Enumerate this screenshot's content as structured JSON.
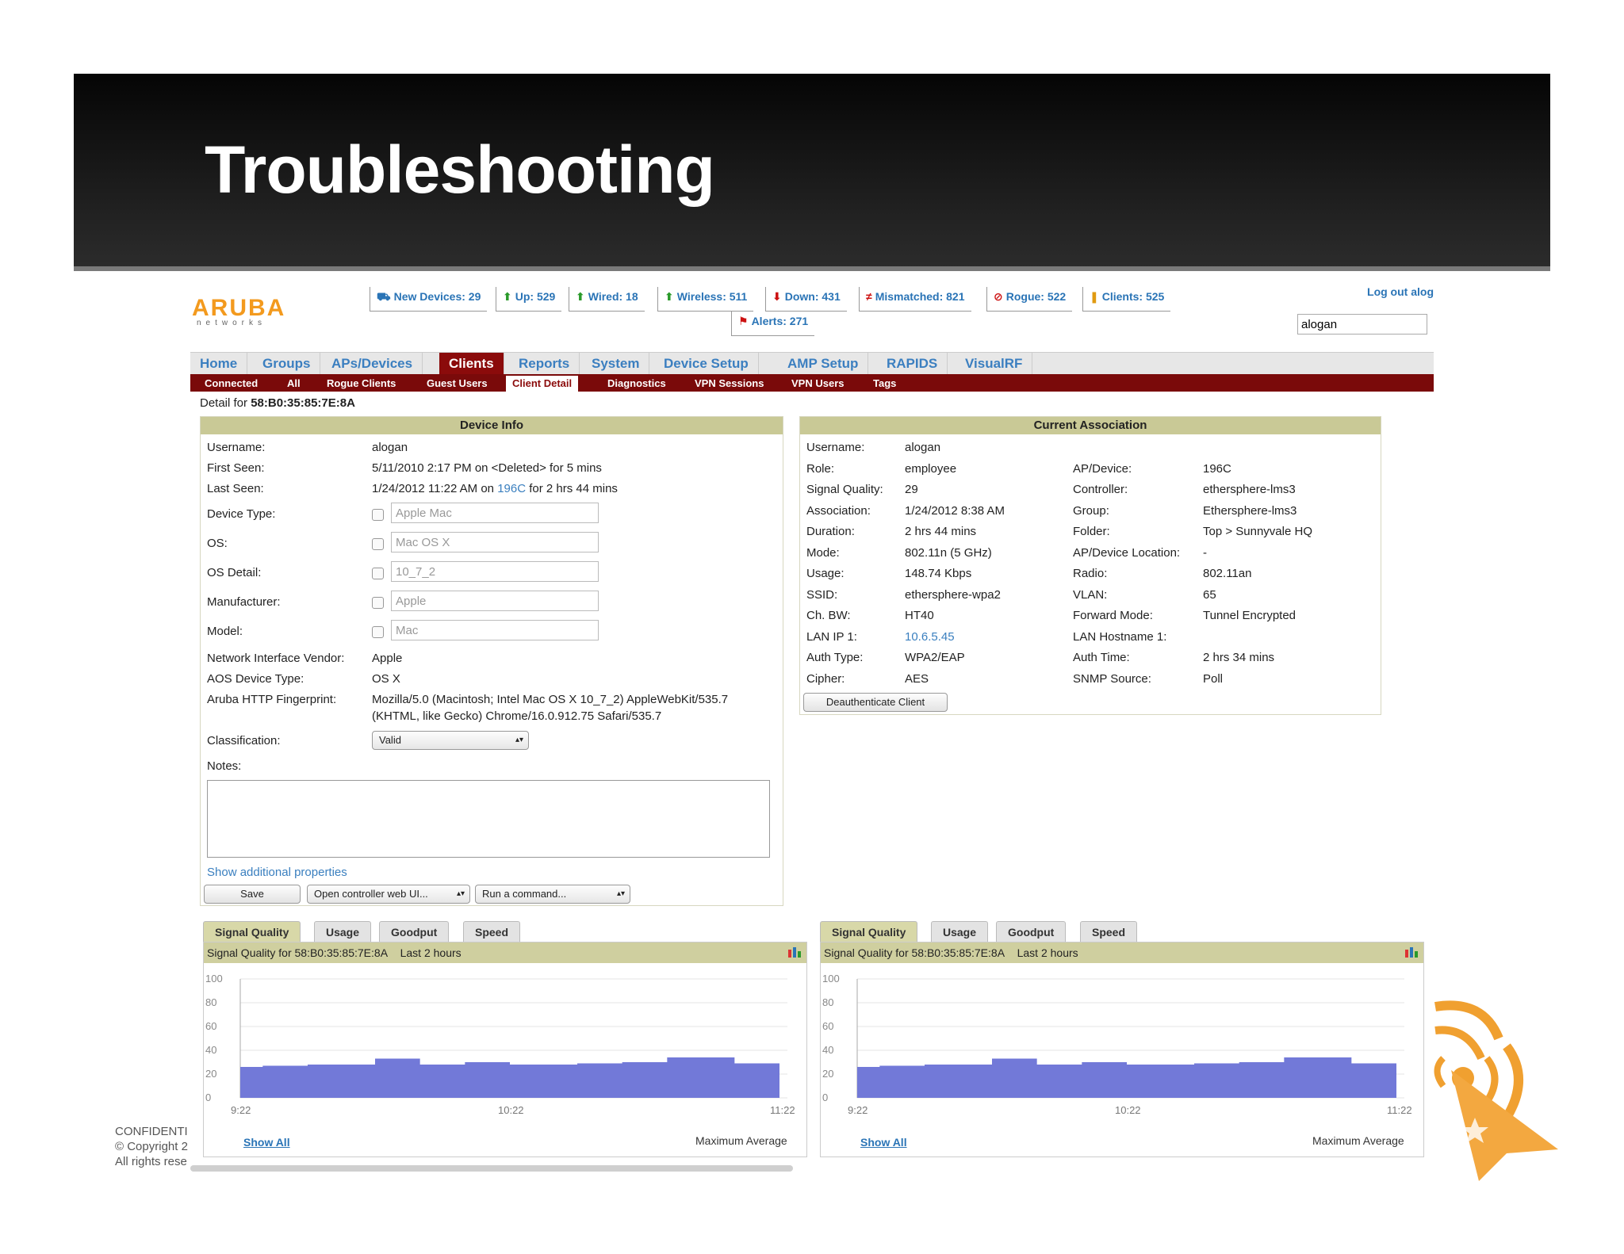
{
  "slide": {
    "title": "Troubleshooting",
    "footer": [
      "CONFIDENTI",
      "© Copyright 2",
      "All rights rese"
    ]
  },
  "colors": {
    "nav_active": "#8b0b0b",
    "link": "#2a74b6",
    "panel_header": "#c9c996",
    "chart_fill": "#7279d8"
  },
  "app": {
    "logo": {
      "word": "ARUBA",
      "sub": "networks"
    },
    "stats": [
      {
        "icon": "new-devices-icon",
        "glyph": "⛟",
        "label": "New Devices: 29"
      },
      {
        "icon": "up-arrow-icon",
        "glyph": "⬆",
        "label": "Up: 529"
      },
      {
        "icon": "wired-arrow-icon",
        "glyph": "⬆",
        "label": "Wired: 18"
      },
      {
        "icon": "wireless-arrow-icon",
        "glyph": "⬆",
        "label": "Wireless: 511"
      },
      {
        "icon": "down-arrow-icon",
        "glyph": "⬇",
        "label": "Down: 431"
      },
      {
        "icon": "mismatched-icon",
        "glyph": "≠",
        "label": "Mismatched: 821"
      },
      {
        "icon": "rogue-icon",
        "glyph": "⊘",
        "label": "Rogue: 522"
      },
      {
        "icon": "clients-icon",
        "glyph": "❚",
        "label": "Clients: 525"
      }
    ],
    "alerts": {
      "icon": "flag-icon",
      "glyph": "⚑",
      "label": "Alerts: 271"
    },
    "logout": "Log out alog",
    "search_value": "alogan",
    "nav": [
      "Home",
      "Groups",
      "APs/Devices",
      "Clients",
      "Reports",
      "System",
      "Device Setup",
      "AMP Setup",
      "RAPIDS",
      "VisualRF"
    ],
    "nav_active": "Clients",
    "subnav": [
      "Connected",
      "All",
      "Rogue Clients",
      "Guest Users",
      "Client Detail",
      "Diagnostics",
      "VPN Sessions",
      "VPN Users",
      "Tags"
    ],
    "subnav_active": "Client Detail",
    "detail_prefix": "Detail for",
    "detail_mac": "58:B0:35:85:7E:8A"
  },
  "device_info": {
    "title": "Device Info",
    "username_label": "Username:",
    "username": "alogan",
    "first_seen_label": "First Seen:",
    "first_seen": "5/11/2010 2:17 PM on <Deleted> for 5 mins",
    "last_seen_label": "Last Seen:",
    "last_seen_pre": "1/24/2012 11:22 AM on",
    "last_seen_link": "196C",
    "last_seen_post": "for 2 hrs 44 mins",
    "editable": [
      {
        "label": "Device Type:",
        "value": "Apple Mac"
      },
      {
        "label": "OS:",
        "value": "Mac OS X"
      },
      {
        "label": "OS Detail:",
        "value": "10_7_2"
      },
      {
        "label": "Manufacturer:",
        "value": "Apple"
      },
      {
        "label": "Model:",
        "value": "Mac"
      }
    ],
    "vendor_label": "Network Interface Vendor:",
    "vendor": "Apple",
    "aos_label": "AOS Device Type:",
    "aos": "OS X",
    "fp_label": "Aruba HTTP Fingerprint:",
    "fp_line1": "Mozilla/5.0 (Macintosh; Intel Mac OS X 10_7_2) AppleWebKit/535.7",
    "fp_line2": "(KHTML, like Gecko) Chrome/16.0.912.75 Safari/535.7",
    "class_label": "Classification:",
    "class_value": "Valid",
    "notes_label": "Notes:",
    "show_more": "Show additional properties",
    "save": "Save",
    "open_controller": "Open controller web UI...",
    "run_command": "Run a command..."
  },
  "assoc": {
    "title": "Current Association",
    "left": [
      {
        "label": "Username:",
        "value": "alogan"
      },
      {
        "label": "Role:",
        "value": "employee"
      },
      {
        "label": "Signal Quality:",
        "value": "29"
      },
      {
        "label": "Association:",
        "value": "1/24/2012 8:38 AM"
      },
      {
        "label": "Duration:",
        "value": "2 hrs 44 mins"
      },
      {
        "label": "Mode:",
        "value": "802.11n (5 GHz)"
      },
      {
        "label": "Usage:",
        "value": "148.74 Kbps"
      },
      {
        "label": "SSID:",
        "value": "ethersphere-wpa2"
      },
      {
        "label": "Ch. BW:",
        "value": "HT40"
      },
      {
        "label": "LAN IP 1:",
        "value": "10.6.5.45"
      },
      {
        "label": "Auth Type:",
        "value": "WPA2/EAP"
      },
      {
        "label": "Cipher:",
        "value": "AES"
      }
    ],
    "right": [
      {
        "label": "AP/Device:",
        "value": "196C"
      },
      {
        "label": "Controller:",
        "value": "ethersphere-lms3"
      },
      {
        "label": "Group:",
        "value": "Ethersphere-lms3"
      },
      {
        "label": "Folder:",
        "value": "Top > Sunnyvale HQ"
      },
      {
        "label": "AP/Device Location:",
        "value": "-"
      },
      {
        "label": "Radio:",
        "value": "802.11an"
      },
      {
        "label": "VLAN:",
        "value": "65"
      },
      {
        "label": "Forward Mode:",
        "value": "Tunnel Encrypted"
      },
      {
        "label": "LAN Hostname 1:",
        "value": ""
      },
      {
        "label": "Auth Time:",
        "value": "2 hrs 34 mins"
      },
      {
        "label": "SNMP Source:",
        "value": "Poll"
      }
    ],
    "deauth": "Deauthenticate Client"
  },
  "chart_panels": [
    {
      "tabs": [
        "Signal Quality",
        "Usage",
        "Goodput",
        "Speed"
      ],
      "active": "Signal Quality",
      "header": "Signal Quality for 58:B0:35:85:7E:8A",
      "range": "Last 2 hours",
      "show_all": "Show All",
      "legend": "Maximum Average"
    },
    {
      "tabs": [
        "Signal Quality",
        "Usage",
        "Goodput",
        "Speed"
      ],
      "active": "Signal Quality",
      "header": "Signal Quality for 58:B0:35:85:7E:8A",
      "range": "Last 2 hours",
      "show_all": "Show All",
      "legend": "Maximum Average"
    }
  ],
  "chart_data": [
    {
      "type": "area",
      "title": "Signal Quality for 58:B0:35:85:7E:8A",
      "x_ticks": [
        "9:22",
        "10:22",
        "11:22"
      ],
      "y_ticks": [
        "100",
        "80",
        "60",
        "40",
        "20",
        "0"
      ],
      "ylim": [
        0,
        100
      ],
      "grid": true,
      "series": [
        {
          "values": [
            26,
            27,
            27,
            28,
            28,
            28,
            33,
            33,
            28,
            28,
            30,
            30,
            28,
            28,
            28,
            29,
            29,
            30,
            30,
            34,
            34,
            34,
            29,
            29
          ]
        }
      ]
    },
    {
      "type": "area",
      "title": "Signal Quality for 58:B0:35:85:7E:8A",
      "x_ticks": [
        "9:22",
        "10:22",
        "11:22"
      ],
      "y_ticks": [
        "100",
        "80",
        "60",
        "40",
        "20",
        "0"
      ],
      "ylim": [
        0,
        100
      ],
      "grid": true,
      "series": [
        {
          "values": [
            26,
            27,
            27,
            28,
            28,
            28,
            33,
            33,
            28,
            28,
            30,
            30,
            28,
            28,
            28,
            29,
            29,
            30,
            30,
            34,
            34,
            34,
            29,
            29
          ]
        }
      ]
    }
  ]
}
